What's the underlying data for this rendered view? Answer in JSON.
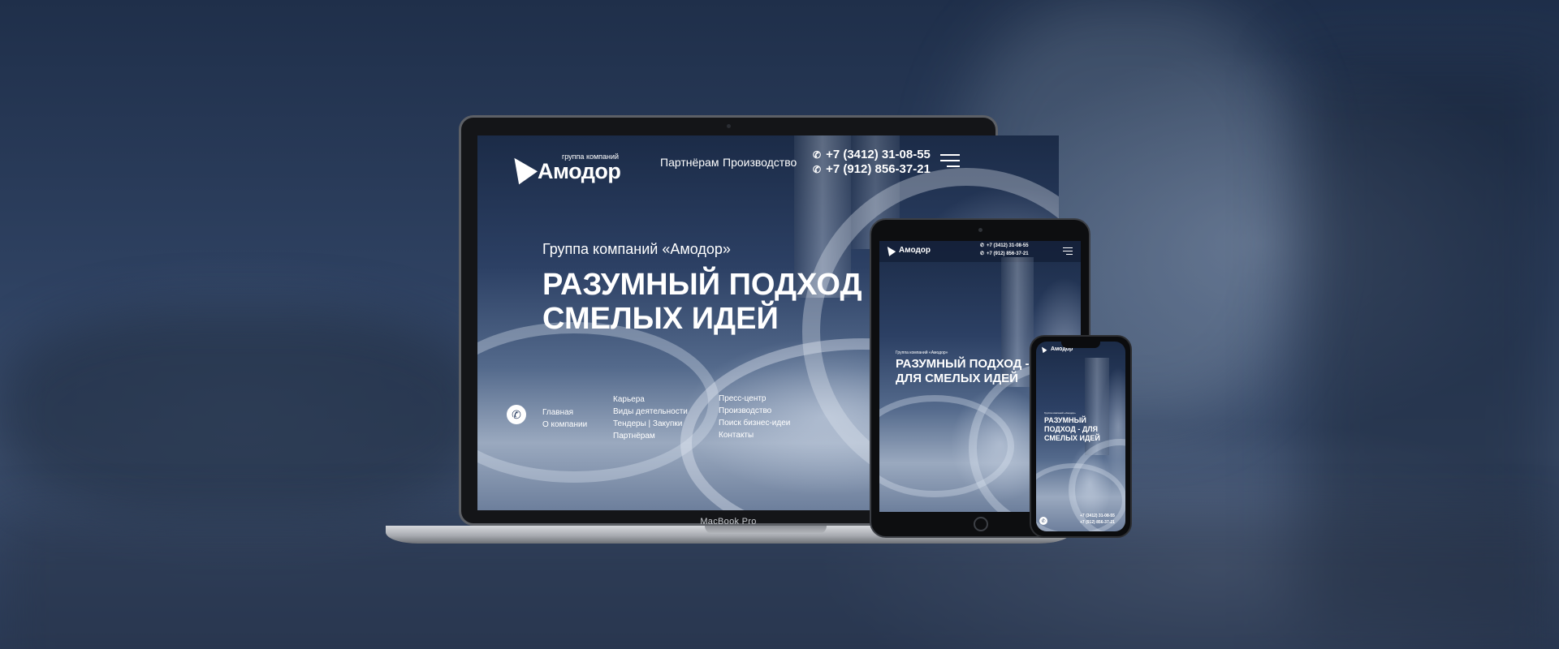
{
  "site": {
    "logo_small": "группа компаний",
    "logo_big": "Амодор",
    "nav": [
      "Партнёрам",
      "Производство"
    ],
    "phones": [
      "+7 (3412) 31-08-55",
      "+7 (912) 856-37-21"
    ],
    "subtitle": "Группа компаний «Амодор»",
    "headline_line1": "РАЗУМНЫЙ ПОДХОД",
    "headline_line2": "СМЕЛЫХ ИДЕЙ",
    "tablet_headline_line1": "РАЗУМНЫЙ ПОДХОД -",
    "tablet_headline_line2": "ДЛЯ СМЕЛЫХ ИДЕЙ",
    "phone_headline_line1": "РАЗУМНЫЙ",
    "phone_headline_line2": "ПОДХОД - ДЛЯ",
    "phone_headline_line3": "СМЕЛЫХ ИДЕЙ",
    "footer_col1": [
      "Главная",
      "О компании"
    ],
    "footer_col2": [
      "Карьера",
      "Виды деятельности",
      "Тендеры | Закупки",
      "Партнёрам"
    ],
    "footer_col3": [
      "Пресс-центр",
      "Производство",
      "Поиск бизнес-идеи",
      "Контакты"
    ]
  },
  "device": {
    "laptop_label": "MacBook Pro"
  },
  "icons": {
    "phone": "phone-icon",
    "menu": "hamburger-menu-icon",
    "logo": "logo-mark-icon"
  }
}
